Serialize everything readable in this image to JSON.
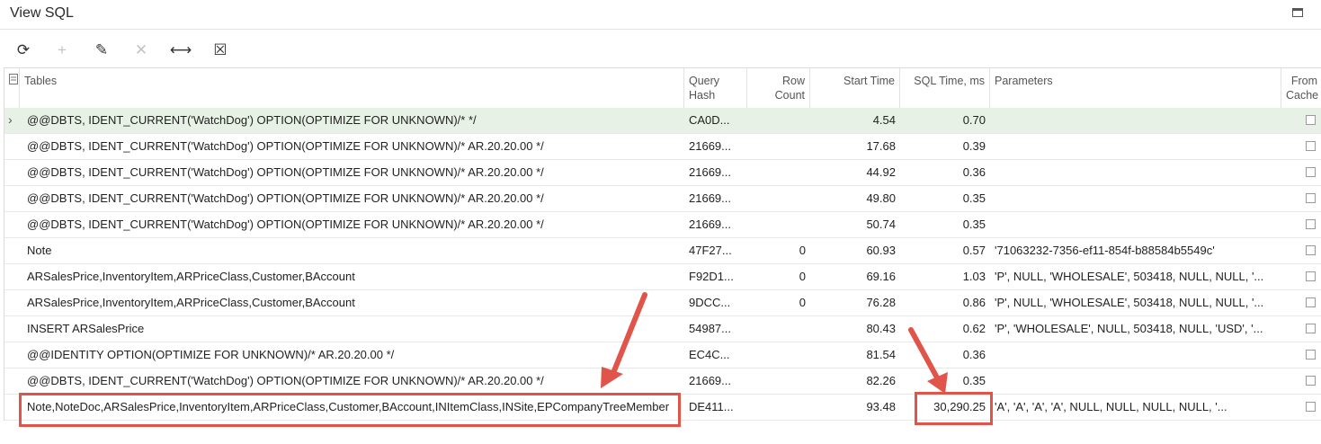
{
  "window": {
    "title": "View SQL"
  },
  "toolbar": {
    "buttons": [
      {
        "name": "refresh-button",
        "icon": "refresh-icon",
        "glyph": "⟳",
        "enabled": true
      },
      {
        "name": "add-button",
        "icon": "plus-icon",
        "glyph": "+",
        "enabled": false
      },
      {
        "name": "edit-button",
        "icon": "pencil-icon",
        "glyph": "✎",
        "enabled": true
      },
      {
        "name": "delete-button",
        "icon": "close-icon",
        "glyph": "✕",
        "enabled": false
      },
      {
        "name": "fit-columns-button",
        "icon": "fit-width-icon",
        "glyph": "⟷",
        "enabled": true
      },
      {
        "name": "export-excel-button",
        "icon": "excel-export-icon",
        "glyph": "☒",
        "enabled": true
      }
    ]
  },
  "columns": {
    "tables": "Tables",
    "query_hash": "Query Hash",
    "row_count": "Row Count",
    "start_time": "Start Time",
    "sql_time": "SQL Time, ms",
    "parameters": "Parameters",
    "from_cache": "From Cache"
  },
  "rows": [
    {
      "tables": "@@DBTS, IDENT_CURRENT('WatchDog') OPTION(OPTIMIZE FOR UNKNOWN)/* */",
      "query_hash": "CA0D...",
      "row_count": "",
      "start_time": "4.54",
      "sql_time": "0.70",
      "parameters": "",
      "from_cache": false,
      "selected": true
    },
    {
      "tables": "@@DBTS, IDENT_CURRENT('WatchDog') OPTION(OPTIMIZE FOR UNKNOWN)/* AR.20.20.00 */",
      "query_hash": "21669...",
      "row_count": "",
      "start_time": "17.68",
      "sql_time": "0.39",
      "parameters": "",
      "from_cache": false
    },
    {
      "tables": "@@DBTS, IDENT_CURRENT('WatchDog') OPTION(OPTIMIZE FOR UNKNOWN)/* AR.20.20.00 */",
      "query_hash": "21669...",
      "row_count": "",
      "start_time": "44.92",
      "sql_time": "0.36",
      "parameters": "",
      "from_cache": false
    },
    {
      "tables": "@@DBTS, IDENT_CURRENT('WatchDog') OPTION(OPTIMIZE FOR UNKNOWN)/* AR.20.20.00 */",
      "query_hash": "21669...",
      "row_count": "",
      "start_time": "49.80",
      "sql_time": "0.35",
      "parameters": "",
      "from_cache": false
    },
    {
      "tables": "@@DBTS, IDENT_CURRENT('WatchDog') OPTION(OPTIMIZE FOR UNKNOWN)/* AR.20.20.00 */",
      "query_hash": "21669...",
      "row_count": "",
      "start_time": "50.74",
      "sql_time": "0.35",
      "parameters": "",
      "from_cache": false
    },
    {
      "tables": "Note",
      "query_hash": "47F27...",
      "row_count": "0",
      "start_time": "60.93",
      "sql_time": "0.57",
      "parameters": "'71063232-7356-ef11-854f-b88584b5549c'",
      "from_cache": false
    },
    {
      "tables": "ARSalesPrice,InventoryItem,ARPriceClass,Customer,BAccount",
      "query_hash": "F92D1...",
      "row_count": "0",
      "start_time": "69.16",
      "sql_time": "1.03",
      "parameters": "'P', NULL, 'WHOLESALE', 503418, NULL, NULL, '...",
      "from_cache": false
    },
    {
      "tables": "ARSalesPrice,InventoryItem,ARPriceClass,Customer,BAccount",
      "query_hash": "9DCC...",
      "row_count": "0",
      "start_time": "76.28",
      "sql_time": "0.86",
      "parameters": "'P', NULL, 'WHOLESALE', 503418, NULL, NULL, '...",
      "from_cache": false
    },
    {
      "tables": "INSERT ARSalesPrice",
      "query_hash": "54987...",
      "row_count": "",
      "start_time": "80.43",
      "sql_time": "0.62",
      "parameters": "'P', 'WHOLESALE', NULL, 503418, NULL, 'USD', '...",
      "from_cache": false
    },
    {
      "tables": "@@IDENTITY OPTION(OPTIMIZE FOR UNKNOWN)/* AR.20.20.00 */",
      "query_hash": "EC4C...",
      "row_count": "",
      "start_time": "81.54",
      "sql_time": "0.36",
      "parameters": "",
      "from_cache": false
    },
    {
      "tables": "@@DBTS, IDENT_CURRENT('WatchDog') OPTION(OPTIMIZE FOR UNKNOWN)/* AR.20.20.00 */",
      "query_hash": "21669...",
      "row_count": "",
      "start_time": "82.26",
      "sql_time": "0.35",
      "parameters": "",
      "from_cache": false
    },
    {
      "tables": "Note,NoteDoc,ARSalesPrice,InventoryItem,ARPriceClass,Customer,BAccount,INItemClass,INSite,EPCompanyTreeMember",
      "query_hash": "DE411...",
      "row_count": "",
      "start_time": "93.48",
      "sql_time": "30,290.25",
      "parameters": "'A', 'A', 'A', 'A', NULL, NULL, NULL, NULL, '...",
      "from_cache": false
    }
  ],
  "annotation_color": "#e0544a"
}
